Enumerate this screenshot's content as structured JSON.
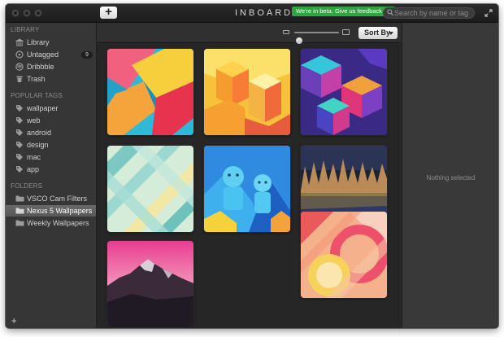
{
  "app": {
    "title": "INBOARD",
    "beta_badge": "We're in beta. Give us feedback",
    "add_label": "+",
    "search_placeholder": "Search by name or tag"
  },
  "sidebar": {
    "library_header": "LIBRARY",
    "library": [
      {
        "label": "Library",
        "icon": "library-icon"
      },
      {
        "label": "Untagged",
        "icon": "untagged-icon",
        "count": "9"
      },
      {
        "label": "Dribbble",
        "icon": "dribbble-icon"
      },
      {
        "label": "Trash",
        "icon": "trash-icon"
      }
    ],
    "tags_header": "POPULAR TAGS",
    "tags": [
      "wallpaper",
      "web",
      "android",
      "design",
      "mac",
      "app"
    ],
    "folders_header": "FOLDERS",
    "folders": [
      {
        "label": "VSCO Cam Filters",
        "selected": false
      },
      {
        "label": "Nexus 5 Wallpapers",
        "selected": true
      },
      {
        "label": "Weekly Wallpapers",
        "selected": false
      }
    ],
    "add_label": "+"
  },
  "toolbar": {
    "sort_label": "Sort By",
    "zoom_level": 0.1
  },
  "grid": {
    "items": [
      {
        "name": "thumb-pink-blue-geometric",
        "style": "geo-pink"
      },
      {
        "name": "thumb-yellow-isometric-city",
        "style": "yellow-city"
      },
      {
        "name": "thumb-purple-cubes",
        "style": "purple-cubes"
      },
      {
        "name": "thumb-teal-diagonal-stripes",
        "style": "teal-stripes"
      },
      {
        "name": "thumb-blue-robots",
        "style": "blue-robots"
      },
      {
        "name": "thumb-forest-lake",
        "style": "forest-lake"
      },
      {
        "name": "thumb-pink-mountains",
        "style": "pink-mountains"
      },
      {
        "name": "thumb-orange-circles",
        "style": "orange-circles"
      }
    ]
  },
  "detail": {
    "empty_text": "Nothing selected"
  }
}
